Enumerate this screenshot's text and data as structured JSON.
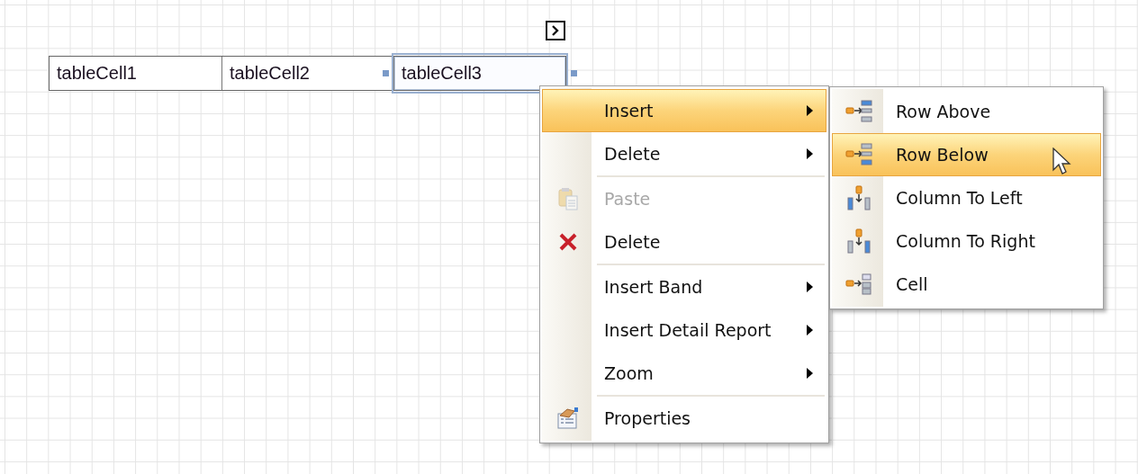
{
  "table": {
    "cells": [
      {
        "text": "tableCell1",
        "selected": false
      },
      {
        "text": "tableCell2",
        "selected": false
      },
      {
        "text": "tableCell3",
        "selected": true
      }
    ]
  },
  "context_menu": {
    "items": [
      {
        "kind": "item",
        "label": "Insert",
        "submenu": true,
        "highlighted": true,
        "disabled": false
      },
      {
        "kind": "item",
        "label": "Delete",
        "submenu": true,
        "highlighted": false,
        "disabled": false
      },
      {
        "kind": "separator"
      },
      {
        "kind": "item",
        "label": "Paste",
        "submenu": false,
        "highlighted": false,
        "disabled": true
      },
      {
        "kind": "item",
        "label": "Delete",
        "submenu": false,
        "highlighted": false,
        "disabled": false
      },
      {
        "kind": "separator"
      },
      {
        "kind": "item",
        "label": "Insert Band",
        "submenu": true,
        "highlighted": false,
        "disabled": false
      },
      {
        "kind": "item",
        "label": "Insert Detail Report",
        "submenu": true,
        "highlighted": false,
        "disabled": false
      },
      {
        "kind": "item",
        "label": "Zoom",
        "submenu": true,
        "highlighted": false,
        "disabled": false
      },
      {
        "kind": "separator"
      },
      {
        "kind": "item",
        "label": "Properties",
        "submenu": false,
        "highlighted": false,
        "disabled": false
      }
    ]
  },
  "submenu": {
    "items": [
      {
        "label": "Row Above",
        "highlighted": false
      },
      {
        "label": "Row Below",
        "highlighted": true
      },
      {
        "label": "Column To Left",
        "highlighted": false
      },
      {
        "label": "Column To Right",
        "highlighted": false
      },
      {
        "label": "Cell",
        "highlighted": false
      }
    ]
  }
}
